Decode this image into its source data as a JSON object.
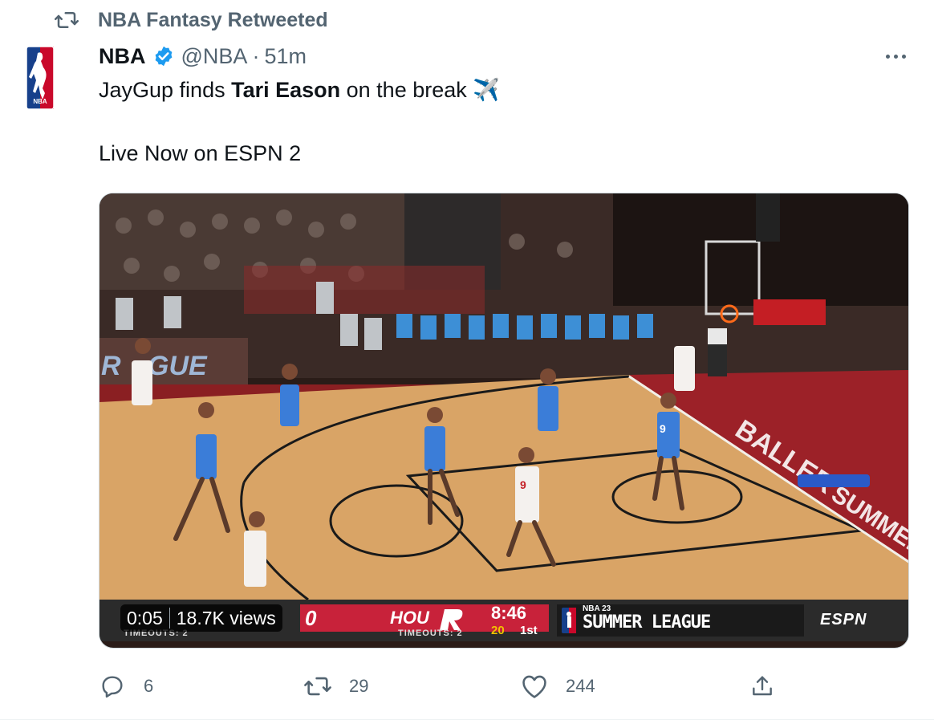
{
  "social_context": {
    "icon": "retweet-icon",
    "text": "NBA Fantasy Retweeted"
  },
  "author": {
    "name": "NBA",
    "verified": true,
    "handle": "@NBA",
    "separator": "·",
    "time": "51m",
    "avatar": "nba-logo"
  },
  "tweet": {
    "line1_before": "JayGup finds ",
    "line1_bold": "Tari Eason",
    "line1_after": " on the break ",
    "line1_emoji": "✈️",
    "line2": "Live Now on ESPN 2"
  },
  "video": {
    "duration": "0:05",
    "views": "18.7K views",
    "scoreboard": {
      "away_score": "0",
      "home_team": "HOU",
      "away_timeouts": "TIMEOUTS: 2",
      "home_timeouts": "TIMEOUTS: 2",
      "game_clock": "8:46",
      "shot_clock": "20",
      "period": "1st",
      "league_small": "NBA 23",
      "league": "SUMMER LEAGUE",
      "network": "ESPN"
    }
  },
  "actions": {
    "reply_count": "6",
    "retweet_count": "29",
    "like_count": "244"
  },
  "colors": {
    "text_primary": "#0f1419",
    "text_secondary": "#536471",
    "verified_blue": "#1d9bf0",
    "rockets_red": "#c8223a"
  }
}
